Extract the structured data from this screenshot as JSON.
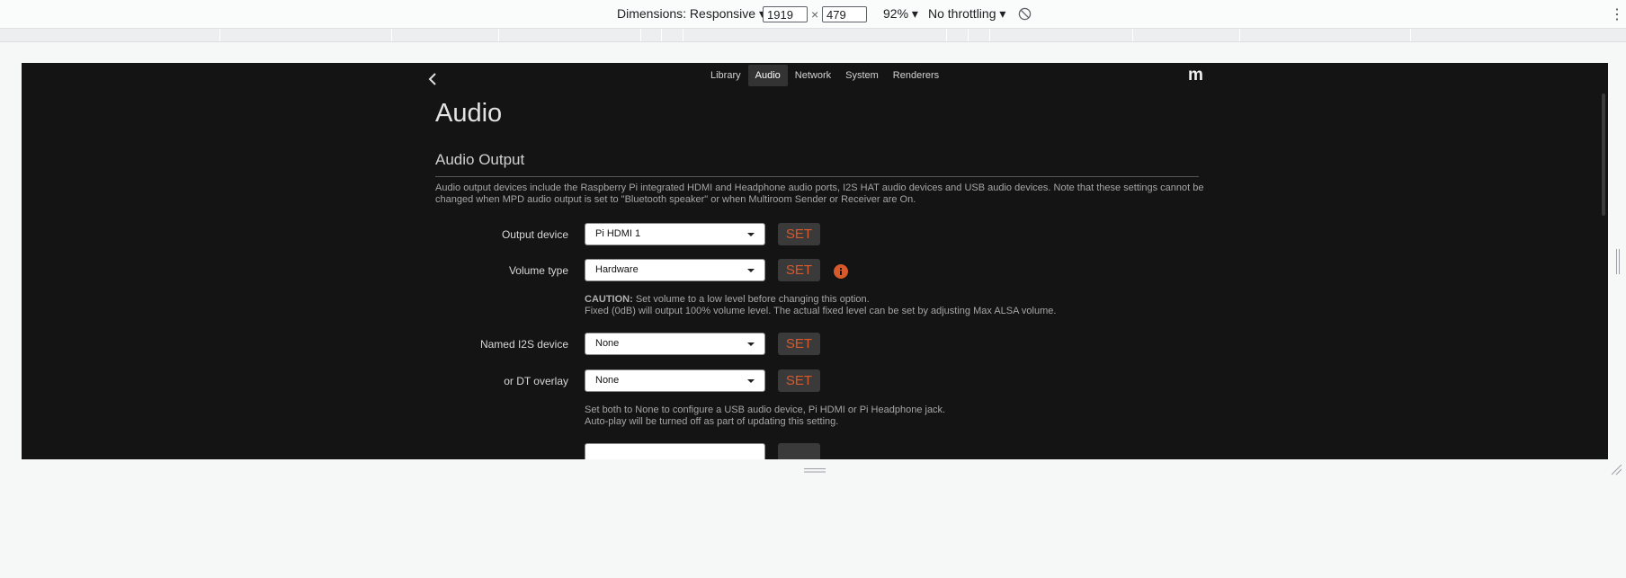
{
  "devtools": {
    "dimensions_label": "Dimensions: Responsive ▾",
    "width": "1919",
    "times": "×",
    "height": "479",
    "zoom": "92% ▾",
    "throttle": "No throttling ▾",
    "rotate_icon": "rotate-icon",
    "more_icon": "more-vert-icon"
  },
  "app": {
    "nav_tabs": [
      {
        "label": "Library"
      },
      {
        "label": "Audio",
        "active": true
      },
      {
        "label": "Network"
      },
      {
        "label": "System"
      },
      {
        "label": "Renderers"
      }
    ],
    "logo": "m",
    "page_title": "Audio",
    "section_title": "Audio Output",
    "description": "Audio output devices include the Raspberry Pi integrated HDMI and Headphone audio ports, I2S HAT audio devices and USB audio devices. Note that these settings cannot be changed when MPD audio output is set to \"Bluetooth speaker\" or when Multiroom Sender or Receiver are On.",
    "set_label": "SET",
    "rows": {
      "output_device": {
        "label": "Output device",
        "value": "Pi HDMI 1"
      },
      "volume_type": {
        "label": "Volume type",
        "value": "Hardware"
      },
      "named_i2s": {
        "label": "Named I2S device",
        "value": "None"
      },
      "dt_overlay": {
        "label": "or DT overlay",
        "value": "None"
      }
    },
    "caution": {
      "prefix": "CAUTION:",
      "line1": " Set volume to a low level before changing this option.",
      "line2": "Fixed (0dB) will output 100% volume level. The actual fixed level can be set by adjusting Max ALSA volume."
    },
    "note2": {
      "line1": "Set both to None to configure a USB audio device, Pi HDMI or Pi Headphone jack.",
      "line2": "Auto-play will be turned off as part of updating this setting."
    },
    "colors": {
      "background": "#141414",
      "accent": "#d65a2b",
      "info": "#d65a2b"
    }
  }
}
